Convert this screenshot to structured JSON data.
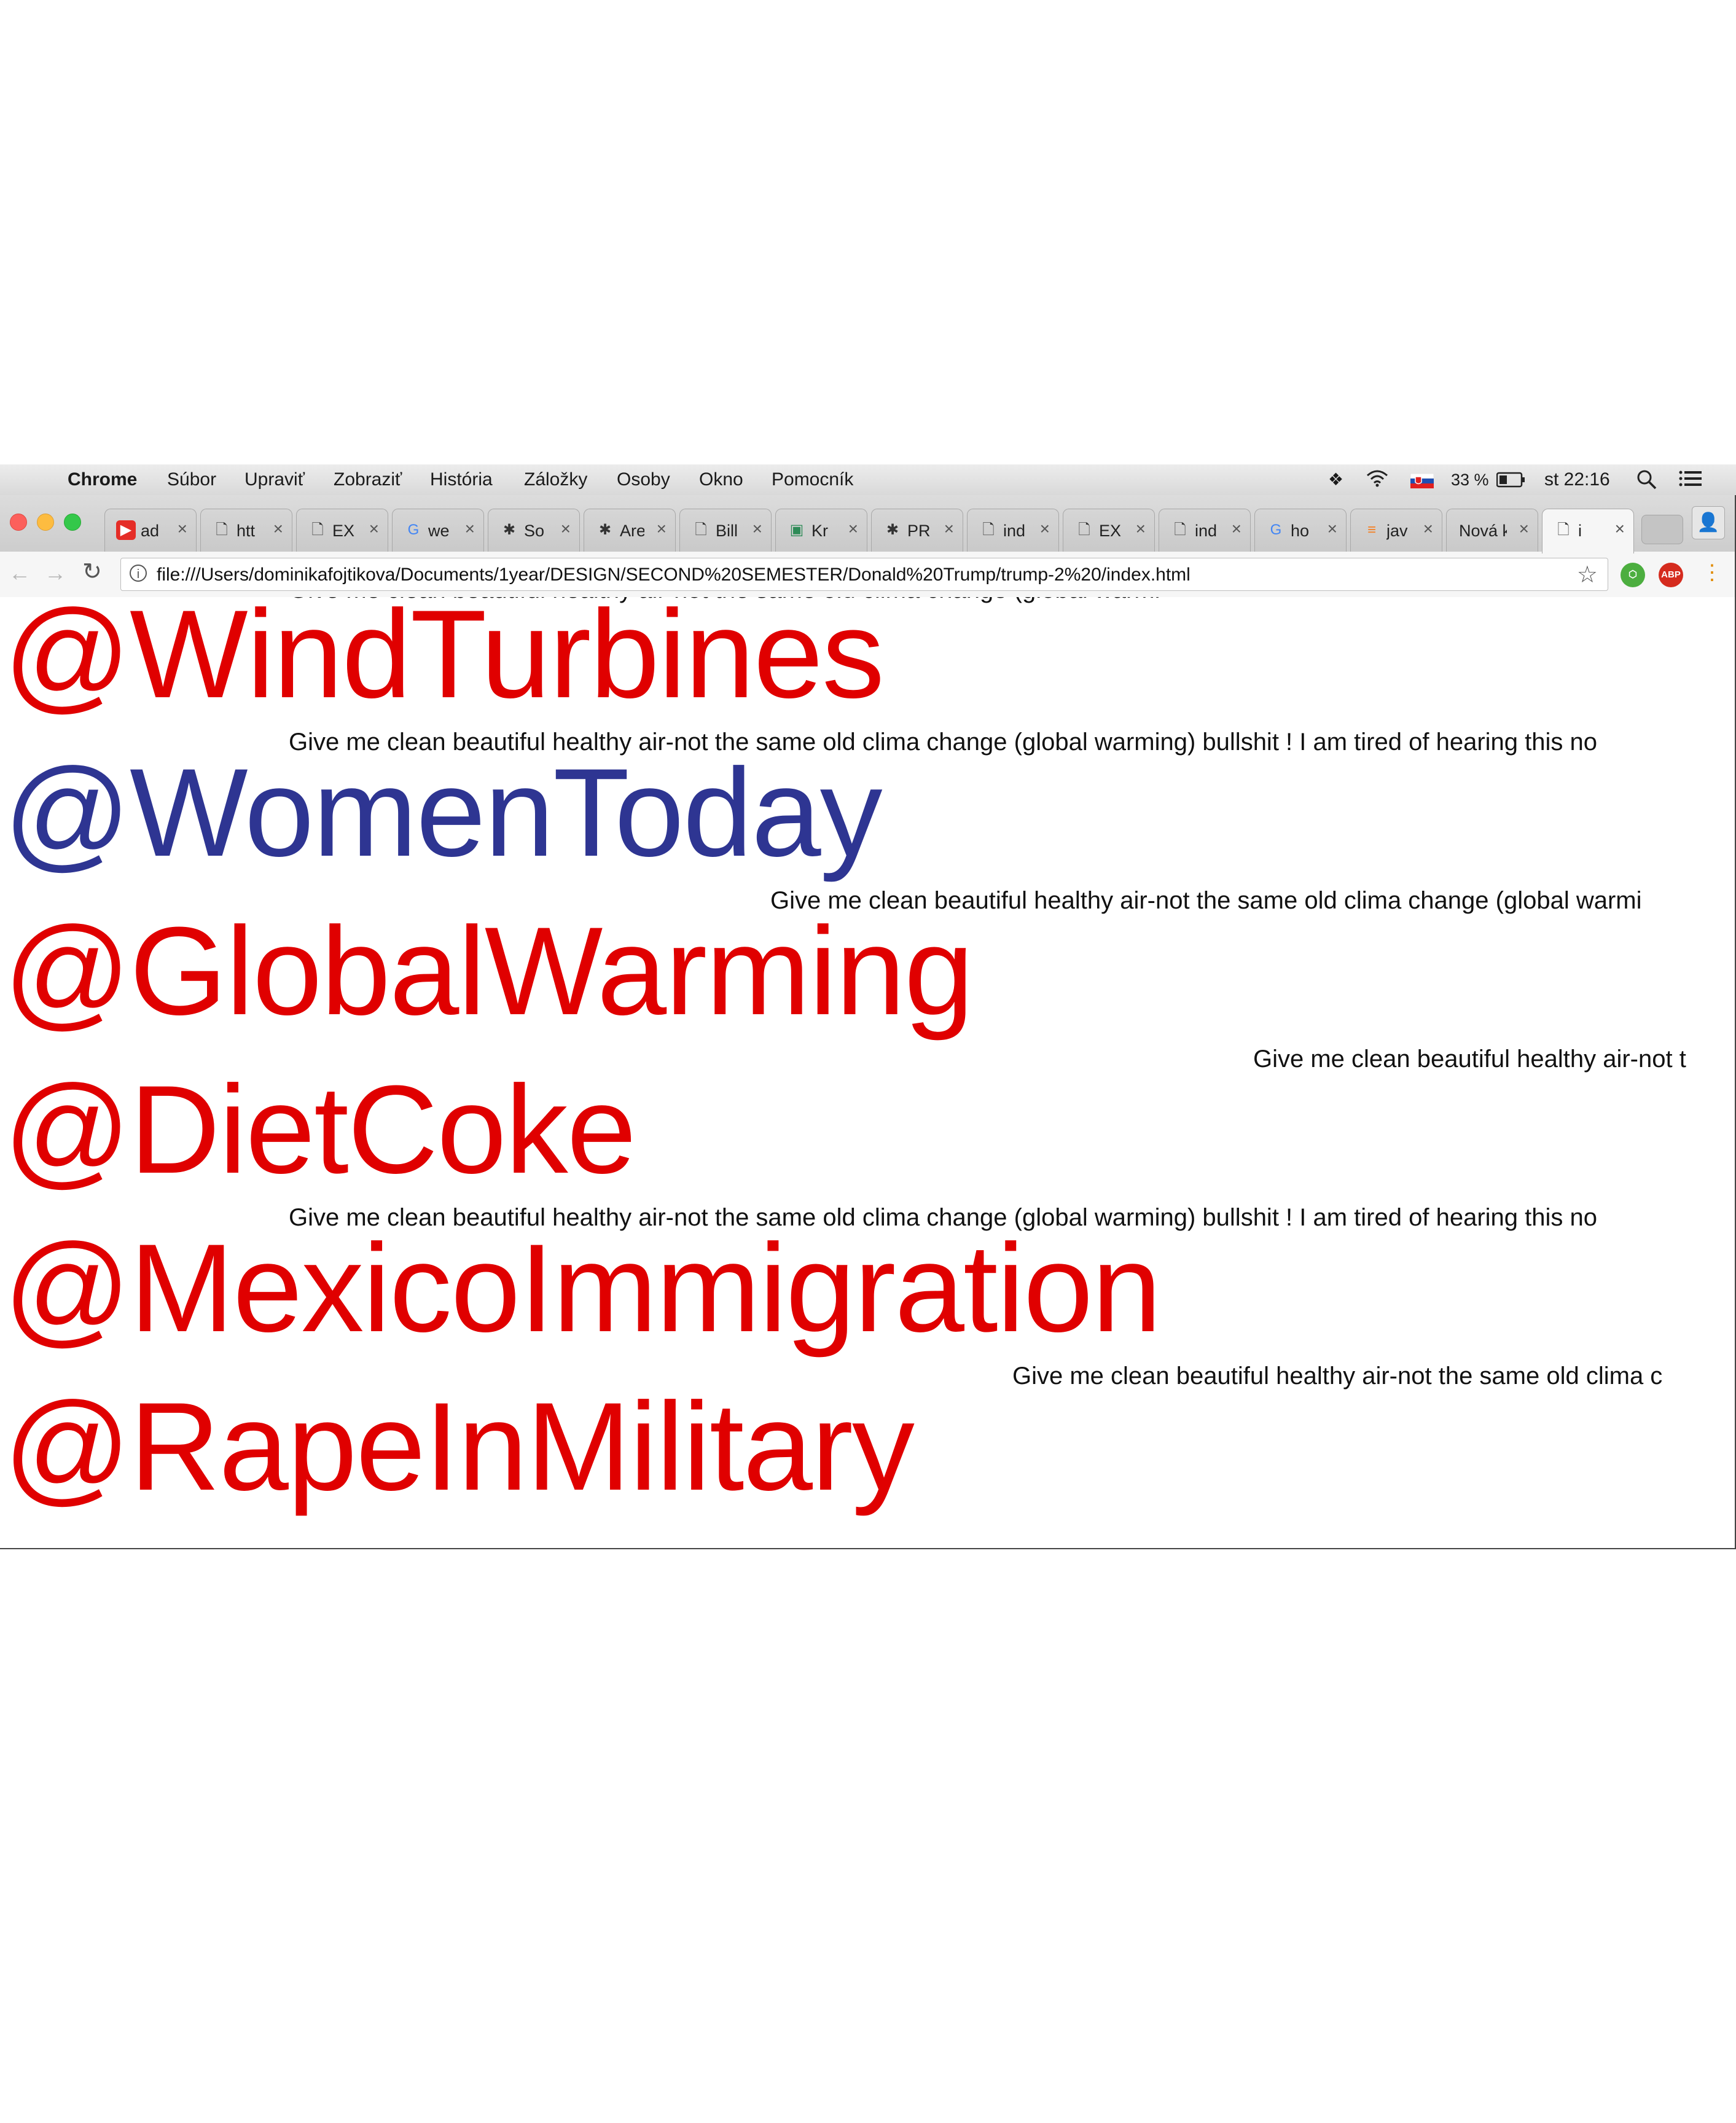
{
  "menubar": {
    "app_name": "Chrome",
    "items": [
      "Súbor",
      "Upraviť",
      "Zobraziť",
      "História",
      "Záložky",
      "Osoby",
      "Okno",
      "Pomocník"
    ],
    "battery": "33 %",
    "clock": "st 22:16"
  },
  "tabs": [
    {
      "label": "ad",
      "icon": "youtube-icon"
    },
    {
      "label": "htt",
      "icon": "document-icon"
    },
    {
      "label": "EX",
      "icon": "document-icon"
    },
    {
      "label": "we",
      "icon": "google-icon"
    },
    {
      "label": "So",
      "icon": "site-icon"
    },
    {
      "label": "Are",
      "icon": "site-icon"
    },
    {
      "label": "Bill",
      "icon": "document-icon"
    },
    {
      "label": "Kr",
      "icon": "tv-icon"
    },
    {
      "label": "PR",
      "icon": "site-icon"
    },
    {
      "label": "ind",
      "icon": "document-icon"
    },
    {
      "label": "EX",
      "icon": "document-icon"
    },
    {
      "label": "ind",
      "icon": "document-icon"
    },
    {
      "label": "ho",
      "icon": "google-icon"
    },
    {
      "label": "jav",
      "icon": "stackoverflow-icon"
    },
    {
      "label": "Nová k",
      "icon": "none"
    },
    {
      "label": "i",
      "icon": "document-icon"
    }
  ],
  "address": {
    "url": "file:///Users/dominikafojtikova/Documents/1year/DESIGN/SECOND%20SEMESTER/Donald%20Trump/trump-2%20/index.html"
  },
  "extensions": {
    "abp_label": "ABP"
  },
  "content": {
    "hashtags": [
      {
        "text": "@WindTurbines",
        "color": "#e00000"
      },
      {
        "text": "@WomenToday",
        "color": "#2e3592"
      },
      {
        "text": "@GlobalWarming",
        "color": "#e00000"
      },
      {
        "text": "@DietCoke",
        "color": "#e00000"
      },
      {
        "text": "@MexicoImmigration",
        "color": "#e00000"
      },
      {
        "text": "@RapeInMilitary",
        "color": "#e00000"
      }
    ],
    "tweets": [
      "Give me clean beautiful healthy air-not the same old clima change (global warming) bullshit ! I am tired of hearing this no",
      "Give me clean beautiful healthy air-not the same old clima change (global warmi",
      "Give me clean beautiful healthy air-not t",
      "Give me clean beautiful healthy air-not the same old clima change (global warming) bullshit ! I am tired of hearing this no",
      "Give me clean beautiful healthy air-not the same old clima c"
    ]
  }
}
